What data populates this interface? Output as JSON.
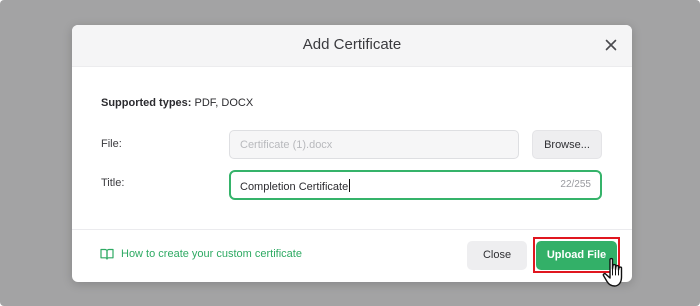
{
  "dialog": {
    "title": "Add Certificate",
    "supported_label": "Supported types:",
    "supported_value": "PDF, DOCX",
    "file_label": "File:",
    "file_placeholder": "Certificate (1).docx",
    "browse_label": "Browse...",
    "title_label": "Title:",
    "title_value": "Completion Certificate",
    "title_counter": "22/255",
    "help_link": "How to create your custom certificate",
    "close_label": "Close",
    "upload_label": "Upload File"
  },
  "icons": {
    "close": "close-icon",
    "help": "book-icon",
    "cursor": "hand-pointer-cursor"
  },
  "colors": {
    "accent": "#33b068",
    "highlight": "#e0161f",
    "overlay": "#a3a3a4"
  }
}
